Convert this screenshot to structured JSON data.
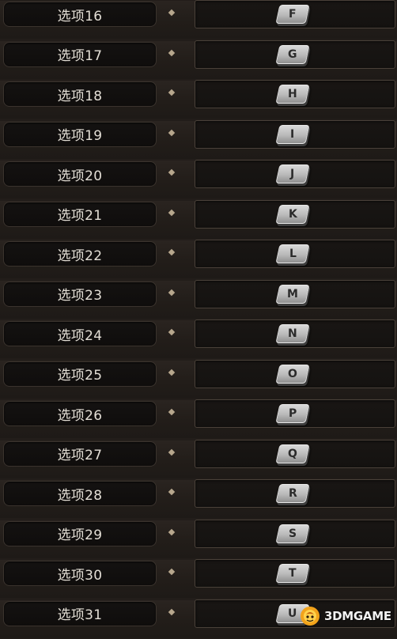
{
  "rows": [
    {
      "label": "选项16",
      "key": "F"
    },
    {
      "label": "选项17",
      "key": "G"
    },
    {
      "label": "选项18",
      "key": "H"
    },
    {
      "label": "选项19",
      "key": "I"
    },
    {
      "label": "选项20",
      "key": "J"
    },
    {
      "label": "选项21",
      "key": "K"
    },
    {
      "label": "选项22",
      "key": "L"
    },
    {
      "label": "选项23",
      "key": "M"
    },
    {
      "label": "选项24",
      "key": "N"
    },
    {
      "label": "选项25",
      "key": "O"
    },
    {
      "label": "选项26",
      "key": "P"
    },
    {
      "label": "选项27",
      "key": "Q"
    },
    {
      "label": "选项28",
      "key": "R"
    },
    {
      "label": "选项29",
      "key": "S"
    },
    {
      "label": "选项30",
      "key": "T"
    },
    {
      "label": "选项31",
      "key": "U"
    }
  ],
  "watermark": {
    "text": "3DMGAME"
  },
  "colors": {
    "background": "#221d1a",
    "label_text": "#e4dfd6",
    "diamond": "#b7a78d",
    "keycap": "#c9c9c9"
  },
  "icons": {
    "separator": "diamond-icon",
    "watermark_logo": "3dm-logo-icon"
  }
}
